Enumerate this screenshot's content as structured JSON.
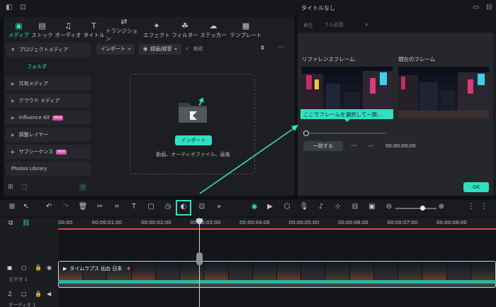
{
  "window": {
    "title": "タイトルなし"
  },
  "tabs": [
    {
      "label": "メディア",
      "icon": "media-icon",
      "active": true
    },
    {
      "label": "ストック",
      "icon": "stock-icon"
    },
    {
      "label": "オーディオ",
      "icon": "music-icon"
    },
    {
      "label": "タイトル",
      "icon": "title-icon"
    },
    {
      "label": "トランジション",
      "icon": "transition-icon"
    },
    {
      "label": "エフェクト",
      "icon": "effect-icon"
    },
    {
      "label": "フィルター",
      "icon": "filter-icon"
    },
    {
      "label": "ステッカー",
      "icon": "sticker-icon"
    },
    {
      "label": "テンプレート",
      "icon": "template-icon"
    }
  ],
  "sidebar": {
    "items": [
      {
        "label": "プロジェクトメディア",
        "expanded": true
      },
      {
        "label": "フォルダ",
        "sub": true
      },
      {
        "label": "共有メディア"
      },
      {
        "label": "クラウド メディア"
      },
      {
        "label": "Influence Kit",
        "badge": "NEW"
      },
      {
        "label": "調整レイヤー"
      },
      {
        "label": "サブシーケンス",
        "badge": "NEW"
      },
      {
        "label": "Photos Library"
      }
    ]
  },
  "media_toolbar": {
    "import_dropdown": "インポート",
    "record_dropdown": "録画/録音",
    "search_placeholder": "検索"
  },
  "drop_zone": {
    "import_button": "インポート",
    "hint": "動画、オーディオファイル、画像"
  },
  "reference_panel": {
    "playback_label": "再生",
    "quality_dropdown": "フル品質",
    "reference_frame_label": "リファレンスフレーム",
    "current_frame_label": "現在のフレーム",
    "tooltip": "ここでフレームを選択して一致...",
    "match_button": "一致する",
    "timecode": "00:00:00:00",
    "ok_button": "OK"
  },
  "timeline": {
    "ticks": [
      "00:00",
      "00:00:01:00",
      "00:00:02:00",
      "00:00:03:00",
      "00:00:04:00",
      "00:00:05:00",
      "00:00:06:00",
      "00:00:07:00",
      "00:00:08:00"
    ],
    "video_track_label": "ビデオ 1",
    "audio_track_label": "オーディオ 1",
    "clip_title": "タイムラプス 仙台 日本"
  },
  "colors": {
    "accent": "#2fe0c2",
    "panel": "#1d1e22",
    "badge": "#e04fb4",
    "playhead_line": "#e0473e"
  }
}
